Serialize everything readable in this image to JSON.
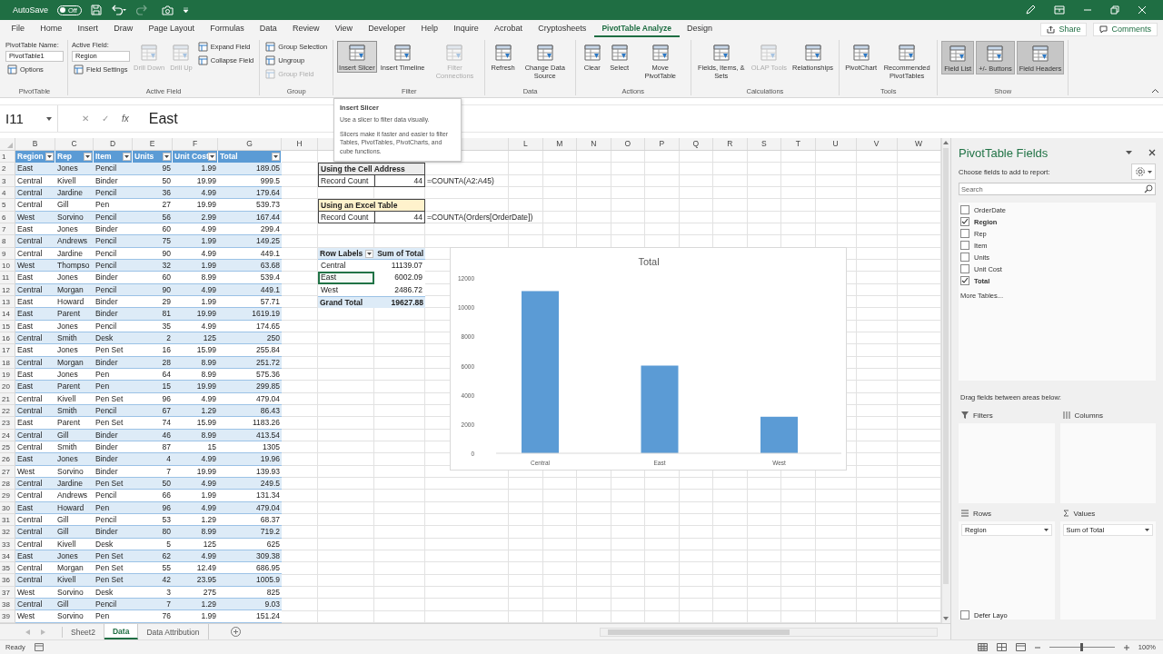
{
  "title_bar": {
    "autosave": {
      "label": "AutoSave",
      "toggle": "Off",
      "on": false
    }
  },
  "menu_tabs": [
    {
      "label": "File",
      "selected": false
    },
    {
      "label": "Home",
      "selected": false
    },
    {
      "label": "Insert",
      "selected": false
    },
    {
      "label": "Draw",
      "selected": false
    },
    {
      "label": "Page Layout",
      "selected": false
    },
    {
      "label": "Formulas",
      "selected": false
    },
    {
      "label": "Data",
      "selected": false
    },
    {
      "label": "Review",
      "selected": false
    },
    {
      "label": "View",
      "selected": false
    },
    {
      "label": "Developer",
      "selected": false
    },
    {
      "label": "Help",
      "selected": false
    },
    {
      "label": "Inquire",
      "selected": false
    },
    {
      "label": "Acrobat",
      "selected": false
    },
    {
      "label": "Cryptosheets",
      "selected": false
    },
    {
      "label": "PivotTable Analyze",
      "selected": true
    },
    {
      "label": "Design",
      "selected": false
    }
  ],
  "share": "Share",
  "comments": "Comments",
  "ribbon": {
    "groups": [
      {
        "label": "PivotTable",
        "columns": [
          [
            {
              "kind": "text",
              "label": "PivotTable Name:"
            },
            {
              "kind": "field",
              "value": "PivotTable1"
            },
            {
              "kind": "small",
              "label": "Options",
              "disabled": false,
              "highlighted": false,
              "on": false
            }
          ]
        ]
      },
      {
        "label": "Active Field",
        "columns": [
          [
            {
              "kind": "text",
              "label": "Active Field:"
            },
            {
              "kind": "field",
              "value": "Region"
            },
            {
              "kind": "small",
              "label": "Field Settings",
              "disabled": false,
              "highlighted": false,
              "on": false
            }
          ],
          [
            {
              "kind": "large",
              "label": "Drill Down",
              "disabled": true,
              "highlighted": false,
              "on": false
            }
          ],
          [
            {
              "kind": "large",
              "label": "Drill Up",
              "disabled": true,
              "highlighted": false,
              "on": false
            }
          ],
          [
            {
              "kind": "small",
              "label": "Expand Field",
              "disabled": false,
              "highlighted": false,
              "on": false
            },
            {
              "kind": "small",
              "label": "Collapse Field",
              "disabled": false,
              "highlighted": false,
              "on": false
            }
          ]
        ]
      },
      {
        "label": "Group",
        "columns": [
          [
            {
              "kind": "small",
              "label": "Group Selection",
              "disabled": false,
              "highlighted": false,
              "on": false
            },
            {
              "kind": "small",
              "label": "Ungroup",
              "disabled": false,
              "highlighted": false,
              "on": false
            },
            {
              "kind": "small",
              "label": "Group Field",
              "disabled": true,
              "highlighted": false,
              "on": false
            }
          ]
        ]
      },
      {
        "label": "Filter",
        "columns": [
          [
            {
              "kind": "large",
              "label": "Insert Slicer",
              "disabled": false,
              "highlighted": true,
              "on": false
            }
          ],
          [
            {
              "kind": "large",
              "label": "Insert Timeline",
              "disabled": false,
              "highlighted": false,
              "on": false
            }
          ],
          [
            {
              "kind": "large",
              "label": "Filter Connections",
              "disabled": true,
              "highlighted": false,
              "on": false
            }
          ]
        ]
      },
      {
        "label": "Data",
        "columns": [
          [
            {
              "kind": "large",
              "label": "Refresh",
              "disabled": false,
              "highlighted": false,
              "on": false
            }
          ],
          [
            {
              "kind": "large",
              "label": "Change Data Source",
              "disabled": false,
              "highlighted": false,
              "on": false
            }
          ]
        ]
      },
      {
        "label": "Actions",
        "columns": [
          [
            {
              "kind": "large",
              "label": "Clear",
              "disabled": false,
              "highlighted": false,
              "on": false
            }
          ],
          [
            {
              "kind": "large",
              "label": "Select",
              "disabled": false,
              "highlighted": false,
              "on": false
            }
          ],
          [
            {
              "kind": "large",
              "label": "Move PivotTable",
              "disabled": false,
              "highlighted": false,
              "on": false
            }
          ]
        ]
      },
      {
        "label": "Calculations",
        "columns": [
          [
            {
              "kind": "large",
              "label": "Fields, Items, & Sets",
              "disabled": false,
              "highlighted": false,
              "on": false
            }
          ],
          [
            {
              "kind": "large",
              "label": "OLAP Tools",
              "disabled": true,
              "highlighted": false,
              "on": false
            }
          ],
          [
            {
              "kind": "large",
              "label": "Relationships",
              "disabled": false,
              "highlighted": false,
              "on": false
            }
          ]
        ]
      },
      {
        "label": "Tools",
        "columns": [
          [
            {
              "kind": "large",
              "label": "PivotChart",
              "disabled": false,
              "highlighted": false,
              "on": false
            }
          ],
          [
            {
              "kind": "large",
              "label": "Recommended PivotTables",
              "disabled": false,
              "highlighted": false,
              "on": false
            }
          ]
        ]
      },
      {
        "label": "Show",
        "columns": [
          [
            {
              "kind": "large",
              "label": "Field List",
              "disabled": false,
              "highlighted": false,
              "on": true
            }
          ],
          [
            {
              "kind": "large",
              "label": "+/- Buttons",
              "disabled": false,
              "highlighted": false,
              "on": true
            }
          ],
          [
            {
              "kind": "large",
              "label": "Field Headers",
              "disabled": false,
              "highlighted": false,
              "on": true
            }
          ]
        ]
      }
    ]
  },
  "formula_bar": {
    "name_box": "I11",
    "buttons": [
      "✕",
      "✓",
      "fx"
    ],
    "formula": "East"
  },
  "tooltip": {
    "title": "Insert Slicer",
    "lines": [
      "Use a slicer to filter data visually.",
      "Slicers make it faster and easier to filter Tables, PivotTables, PivotCharts, and cube functions."
    ]
  },
  "sheet": {
    "column_letters_left": [
      "B",
      "C",
      "D",
      "E",
      "F",
      "G",
      "H"
    ],
    "column_letters_right": [
      "L",
      "M",
      "N",
      "O",
      "P",
      "Q",
      "R",
      "S",
      "T",
      "U",
      "V",
      "W"
    ],
    "row_numbers": [
      "1",
      "2",
      "3",
      "4",
      "5",
      "6",
      "7",
      "8",
      "9",
      "10",
      "11",
      "12",
      "13",
      "14",
      "15",
      "16",
      "17",
      "18",
      "19",
      "20",
      "21",
      "22",
      "23",
      "24",
      "25",
      "26",
      "27",
      "28",
      "29",
      "30",
      "31",
      "32",
      "33",
      "34",
      "35",
      "36",
      "37",
      "38",
      "39"
    ]
  },
  "table": {
    "header": [
      "Region",
      "Rep",
      "Item",
      "Units",
      "Unit Cost",
      "Total"
    ],
    "rows": [
      [
        "East",
        "Jones",
        "Pencil",
        "95",
        "1.99",
        "189.05"
      ],
      [
        "Central",
        "Kivell",
        "Binder",
        "50",
        "19.99",
        "999.5"
      ],
      [
        "Central",
        "Jardine",
        "Pencil",
        "36",
        "4.99",
        "179.64"
      ],
      [
        "Central",
        "Gill",
        "Pen",
        "27",
        "19.99",
        "539.73"
      ],
      [
        "West",
        "Sorvino",
        "Pencil",
        "56",
        "2.99",
        "167.44"
      ],
      [
        "East",
        "Jones",
        "Binder",
        "60",
        "4.99",
        "299.4"
      ],
      [
        "Central",
        "Andrews",
        "Pencil",
        "75",
        "1.99",
        "149.25"
      ],
      [
        "Central",
        "Jardine",
        "Pencil",
        "90",
        "4.99",
        "449.1"
      ],
      [
        "West",
        "Thompso",
        "Pencil",
        "32",
        "1.99",
        "63.68"
      ],
      [
        "East",
        "Jones",
        "Binder",
        "60",
        "8.99",
        "539.4"
      ],
      [
        "Central",
        "Morgan",
        "Pencil",
        "90",
        "4.99",
        "449.1"
      ],
      [
        "East",
        "Howard",
        "Binder",
        "29",
        "1.99",
        "57.71"
      ],
      [
        "East",
        "Parent",
        "Binder",
        "81",
        "19.99",
        "1619.19"
      ],
      [
        "East",
        "Jones",
        "Pencil",
        "35",
        "4.99",
        "174.65"
      ],
      [
        "Central",
        "Smith",
        "Desk",
        "2",
        "125",
        "250"
      ],
      [
        "East",
        "Jones",
        "Pen Set",
        "16",
        "15.99",
        "255.84"
      ],
      [
        "Central",
        "Morgan",
        "Binder",
        "28",
        "8.99",
        "251.72"
      ],
      [
        "East",
        "Jones",
        "Pen",
        "64",
        "8.99",
        "575.36"
      ],
      [
        "East",
        "Parent",
        "Pen",
        "15",
        "19.99",
        "299.85"
      ],
      [
        "Central",
        "Kivell",
        "Pen Set",
        "96",
        "4.99",
        "479.04"
      ],
      [
        "Central",
        "Smith",
        "Pencil",
        "67",
        "1.29",
        "86.43"
      ],
      [
        "East",
        "Parent",
        "Pen Set",
        "74",
        "15.99",
        "1183.26"
      ],
      [
        "Central",
        "Gill",
        "Binder",
        "46",
        "8.99",
        "413.54"
      ],
      [
        "Central",
        "Smith",
        "Binder",
        "87",
        "15",
        "1305"
      ],
      [
        "East",
        "Jones",
        "Binder",
        "4",
        "4.99",
        "19.96"
      ],
      [
        "West",
        "Sorvino",
        "Binder",
        "7",
        "19.99",
        "139.93"
      ],
      [
        "Central",
        "Jardine",
        "Pen Set",
        "50",
        "4.99",
        "249.5"
      ],
      [
        "Central",
        "Andrews",
        "Pencil",
        "66",
        "1.99",
        "131.34"
      ],
      [
        "East",
        "Howard",
        "Pen",
        "96",
        "4.99",
        "479.04"
      ],
      [
        "Central",
        "Gill",
        "Pencil",
        "53",
        "1.29",
        "68.37"
      ],
      [
        "Central",
        "Gill",
        "Binder",
        "80",
        "8.99",
        "719.2"
      ],
      [
        "Central",
        "Kivell",
        "Desk",
        "5",
        "125",
        "625"
      ],
      [
        "East",
        "Jones",
        "Pen Set",
        "62",
        "4.99",
        "309.38"
      ],
      [
        "Central",
        "Morgan",
        "Pen Set",
        "55",
        "12.49",
        "686.95"
      ],
      [
        "Central",
        "Kivell",
        "Pen Set",
        "42",
        "23.95",
        "1005.9"
      ],
      [
        "West",
        "Sorvino",
        "Desk",
        "3",
        "275",
        "825"
      ],
      [
        "Central",
        "Gill",
        "Pencil",
        "7",
        "1.29",
        "9.03"
      ],
      [
        "West",
        "Sorvino",
        "Pen",
        "76",
        "1.99",
        "151.24"
      ]
    ]
  },
  "summaries": [
    {
      "kind": "plain",
      "title": "Using the Cell Address",
      "label": "Record Count",
      "value": "44",
      "formula": "=COUNTA(A2:A45)"
    },
    {
      "kind": "highlight",
      "title": "Using an Excel Table",
      "label": "Record Count",
      "value": "44",
      "formula": "=COUNTA(Orders[OrderDate])"
    }
  ],
  "pivot": {
    "header": [
      "Row Labels",
      "Sum of Total"
    ],
    "rows": [
      {
        "label": "Central",
        "value": "11139.07",
        "selected": false
      },
      {
        "label": "East",
        "value": "6002.09",
        "selected": true
      },
      {
        "label": "West",
        "value": "2486.72",
        "selected": false
      }
    ],
    "total": {
      "label": "Grand Total",
      "value": "19627.88"
    }
  },
  "pivot_chart": {
    "chart_data": {
      "type": "bar",
      "title": "Total",
      "categories": [
        "Central",
        "East",
        "West"
      ],
      "series": [
        {
          "color": "#5b9bd5",
          "values": [
            11100,
            6000,
            2500
          ]
        }
      ],
      "ylim": [
        0,
        12000
      ],
      "yticks": [
        0,
        2000,
        4000,
        6000,
        8000,
        10000,
        12000
      ]
    }
  },
  "task_pane": {
    "title": "PivotTable Fields",
    "subtitle": "Choose fields to add to report:",
    "search_placeholder": "Search",
    "fields": [
      {
        "label": "OrderDate",
        "checked": false
      },
      {
        "label": "Region",
        "checked": true
      },
      {
        "label": "Rep",
        "checked": false
      },
      {
        "label": "Item",
        "checked": false
      },
      {
        "label": "Units",
        "checked": false
      },
      {
        "label": "Unit Cost",
        "checked": false
      },
      {
        "label": "Total",
        "checked": true
      }
    ],
    "more_tables": "More Tables...",
    "drag_hint": "Drag fields between areas below:",
    "areas": [
      {
        "kind": "filters",
        "label": "Filters"
      },
      {
        "kind": "columns",
        "label": "Columns"
      },
      {
        "kind": "rows",
        "label": "Rows",
        "items": [
          "Region"
        ]
      },
      {
        "kind": "values",
        "label": "Values",
        "items": [
          "Sum of Total"
        ]
      }
    ],
    "defer": {
      "label": "Defer Layo",
      "checked": false
    }
  },
  "sheet_tabs": [
    {
      "label": "Sheet2",
      "selected": false
    },
    {
      "label": "Data",
      "selected": true
    },
    {
      "label": "Data Attribution",
      "selected": false
    }
  ],
  "status_bar": {
    "status": "Ready",
    "zoom": {
      "level": 0.5,
      "reading": "100%"
    }
  }
}
